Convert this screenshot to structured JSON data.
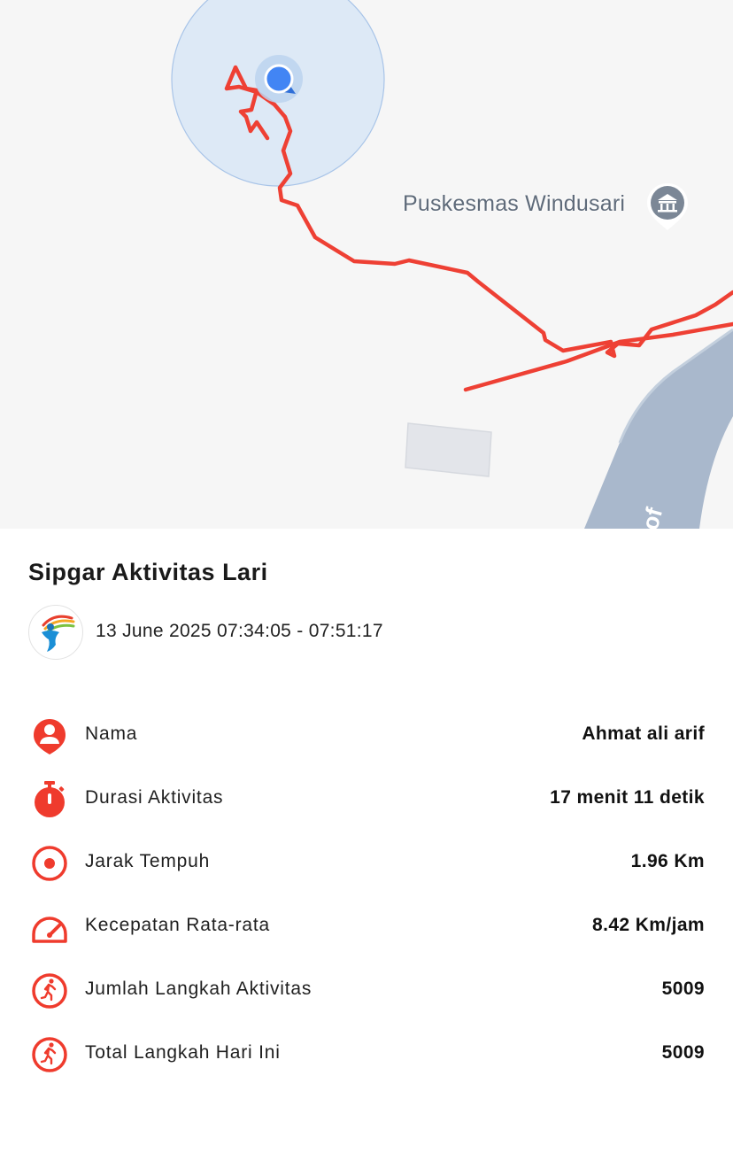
{
  "map": {
    "poi_label": "Puskesmas Windusari",
    "road_label_fragment": "of",
    "colors": {
      "route": "#ee4034",
      "water": "#a9b8cc",
      "accuracy_circle": "#dde9f6",
      "location_dot": "#4285f4"
    }
  },
  "activity": {
    "title": "Sipgar Aktivitas Lari",
    "datetime": "13 June 2025 07:34:05 - 07:51:17"
  },
  "stats": [
    {
      "icon": "person-pin-icon",
      "label": "Nama",
      "value": "Ahmat ali arif"
    },
    {
      "icon": "stopwatch-icon",
      "label": "Durasi Aktivitas",
      "value": "17 menit 11 detik"
    },
    {
      "icon": "target-icon",
      "label": "Jarak Tempuh",
      "value": "1.96 Km"
    },
    {
      "icon": "speedometer-icon",
      "label": "Kecepatan Rata-rata",
      "value": "8.42 Km/jam"
    },
    {
      "icon": "running-icon",
      "label": "Jumlah Langkah Aktivitas",
      "value": "5009"
    },
    {
      "icon": "running-icon",
      "label": "Total Langkah Hari Ini",
      "value": "5009"
    }
  ],
  "accent_color": "#ef3b2d"
}
